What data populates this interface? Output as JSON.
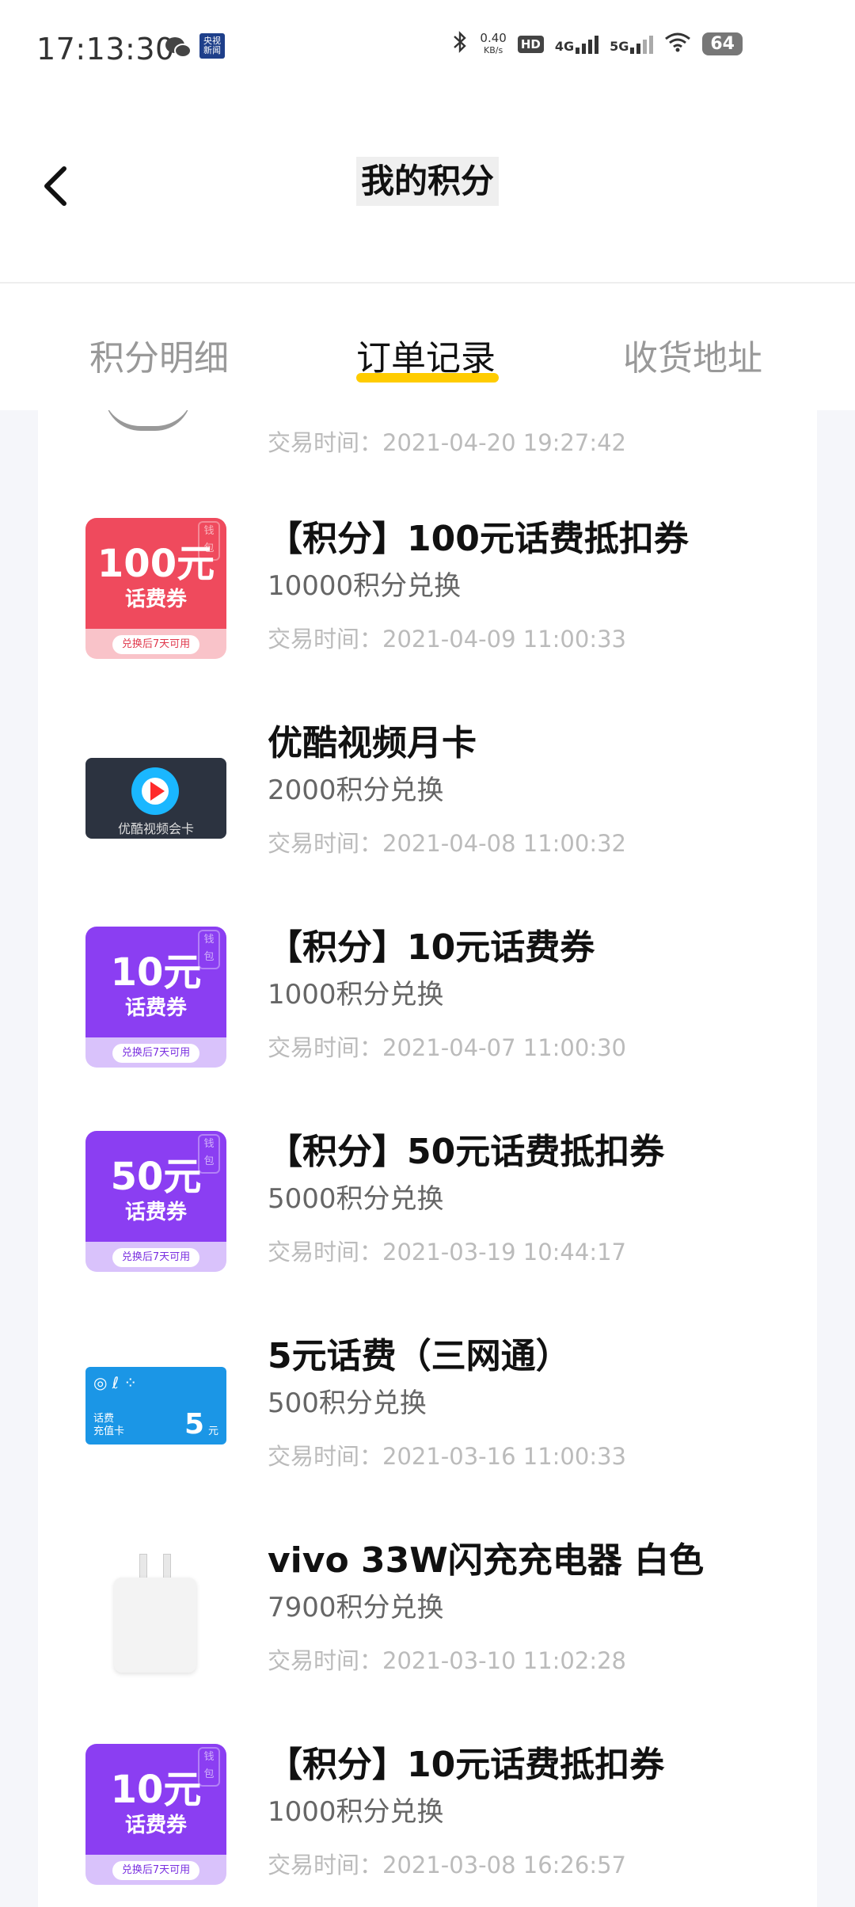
{
  "status_bar": {
    "time": "17:13:30",
    "badge_text": "央视\n新闻",
    "net_speed_value": "0.40",
    "net_speed_unit": "KB/s",
    "hd_label": "HD",
    "sim1_label": "4G",
    "sim2_label": "5G",
    "battery": "64"
  },
  "header": {
    "title": "我的积分"
  },
  "tabs": [
    {
      "label": "积分明细",
      "active": false
    },
    {
      "label": "订单记录",
      "active": true
    },
    {
      "label": "收货地址",
      "active": false
    }
  ],
  "colors": {
    "accent": "#ffcc00",
    "voucher_red": "#ef4a5d",
    "voucher_purple": "#8b3ef2",
    "telecom_blue": "#1b96e6"
  },
  "orders": [
    {
      "name": "",
      "points": "",
      "time": "交易时间：2021-04-20 19:27:42"
    },
    {
      "name": "【积分】100元话费抵扣券",
      "points": "10000积分兑换",
      "time": "交易时间：2021-04-09 11:00:33",
      "thumb": {
        "amount": "100元",
        "sub": "话费券",
        "pill": "兑换后7天可用",
        "purse": "钱包"
      }
    },
    {
      "name": "优酷视频月卡",
      "points": "2000积分兑换",
      "time": "交易时间：2021-04-08 11:00:32",
      "thumb": {
        "caption": "优酷视频会卡"
      }
    },
    {
      "name": "【积分】10元话费券",
      "points": "1000积分兑换",
      "time": "交易时间：2021-04-07 11:00:30",
      "thumb": {
        "amount": "10元",
        "sub": "话费券",
        "pill": "兑换后7天可用",
        "purse": "钱包"
      }
    },
    {
      "name": "【积分】50元话费抵扣券",
      "points": "5000积分兑换",
      "time": "交易时间：2021-03-19 10:44:17",
      "thumb": {
        "amount": "50元",
        "sub": "话费券",
        "pill": "兑换后7天可用",
        "purse": "钱包"
      }
    },
    {
      "name": "5元话费（三网通）",
      "points": "500积分兑换",
      "time": "交易时间：2021-03-16 11:00:33",
      "thumb": {
        "label": "话费\n充值卡",
        "amount": "5",
        "unit": "元"
      }
    },
    {
      "name": "vivo 33W闪充充电器 白色",
      "points": "7900积分兑换",
      "time": "交易时间：2021-03-10 11:02:28"
    },
    {
      "name": "【积分】10元话费抵扣券",
      "points": "1000积分兑换",
      "time": "交易时间：2021-03-08 16:26:57",
      "thumb": {
        "amount": "10元",
        "sub": "话费券",
        "pill": "兑换后7天可用",
        "purse": "钱包"
      }
    }
  ]
}
